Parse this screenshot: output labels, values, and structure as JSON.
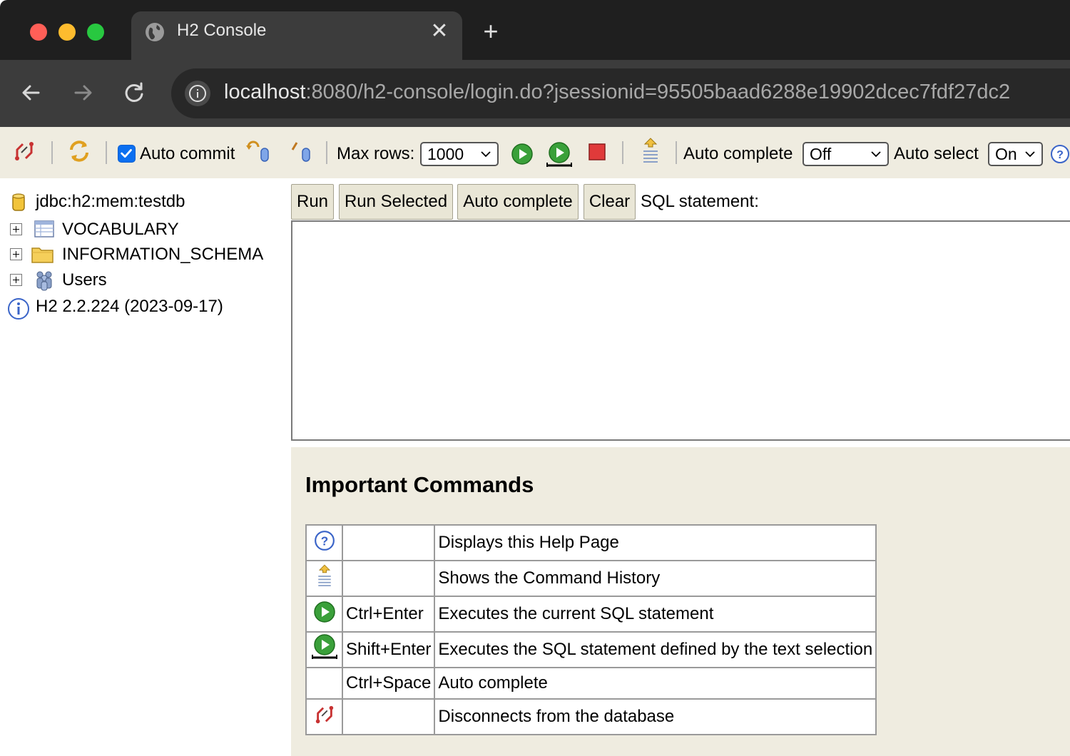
{
  "browser": {
    "tab_title": "H2 Console",
    "tab_close": "✕",
    "new_tab": "+",
    "url_host": "localhost",
    "url_rest": ":8080/h2-console/login.do?jsessionid=95505baad6288e19902dcec7fdf27dc2"
  },
  "toolbar": {
    "auto_commit_label": "Auto commit",
    "auto_commit_checked": true,
    "max_rows_label": "Max rows:",
    "max_rows_value": "1000",
    "auto_complete_label": "Auto complete",
    "auto_complete_value": "Off",
    "auto_select_label": "Auto select",
    "auto_select_value": "On"
  },
  "tree": {
    "connection": "jdbc:h2:mem:testdb",
    "items": [
      {
        "label": "VOCABULARY",
        "icon": "table-icon"
      },
      {
        "label": "INFORMATION_SCHEMA",
        "icon": "folder-icon"
      },
      {
        "label": "Users",
        "icon": "users-icon"
      }
    ],
    "version": "H2 2.2.224 (2023-09-17)"
  },
  "query": {
    "run_label": "Run",
    "run_selected_label": "Run Selected",
    "auto_complete_label": "Auto complete",
    "clear_label": "Clear",
    "sql_statement_label": "SQL statement:",
    "sql_text": ""
  },
  "help": {
    "title": "Important Commands",
    "commands": [
      {
        "icon": "help-icon",
        "key": "",
        "description": "Displays this Help Page"
      },
      {
        "icon": "history-icon",
        "key": "",
        "description": "Shows the Command History"
      },
      {
        "icon": "run-icon",
        "key": "Ctrl+Enter",
        "description": "Executes the current SQL statement"
      },
      {
        "icon": "run-selected-icon",
        "key": "Shift+Enter",
        "description": "Executes the SQL statement defined by the text selection"
      },
      {
        "icon": "",
        "key": "Ctrl+Space",
        "description": "Auto complete"
      },
      {
        "icon": "disconnect-icon",
        "key": "",
        "description": "Disconnects from the database"
      }
    ]
  }
}
